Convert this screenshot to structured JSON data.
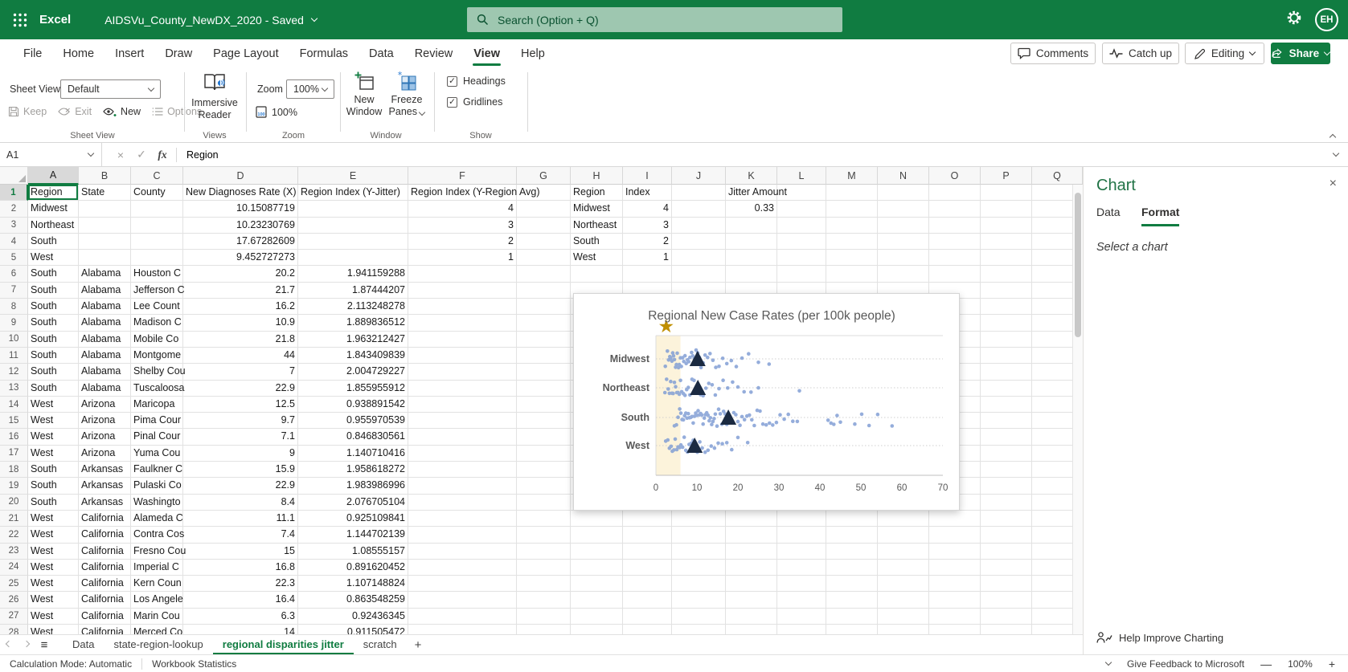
{
  "colors": {
    "brand_green": "#107C41",
    "panel_title_green": "#217346",
    "dot_blue": "#7E9CD4",
    "triangle_navy": "#1B2A41",
    "star_gold": "#C08F00",
    "band_cream": "#FCF3DB"
  },
  "titlebar": {
    "app_name": "Excel",
    "document_title": "AIDSVu_County_NewDX_2020  -  Saved",
    "search_placeholder": "Search (Option + Q)",
    "avatar_initials": "EH"
  },
  "ribbon_tabs": [
    "File",
    "Home",
    "Insert",
    "Draw",
    "Page Layout",
    "Formulas",
    "Data",
    "Review",
    "View",
    "Help"
  ],
  "active_ribbon_tab": "View",
  "header_actions": {
    "comments": "Comments",
    "catch_up": "Catch up",
    "editing": "Editing",
    "share": "Share"
  },
  "ribbon": {
    "sheet_view": {
      "label": "Sheet View",
      "value": "Default",
      "keep": "Keep",
      "exit": "Exit",
      "new": "New",
      "options": "Options",
      "group_label": "Sheet View"
    },
    "views": {
      "immersive_reader": "Immersive Reader",
      "group_label": "Views"
    },
    "zoom": {
      "label": "Zoom",
      "value": "100%",
      "zoom_to_100": "100%",
      "group_label": "Zoom"
    },
    "window": {
      "new_window": "New Window",
      "freeze_panes": "Freeze Panes",
      "group_label": "Window"
    },
    "show": {
      "headings": "Headings",
      "gridlines": "Gridlines",
      "group_label": "Show"
    }
  },
  "formula_bar": {
    "name_box": "A1",
    "content": "Region"
  },
  "grid": {
    "column_letters": [
      "A",
      "B",
      "C",
      "D",
      "E",
      "F",
      "G",
      "H",
      "I",
      "J",
      "K",
      "L",
      "M",
      "N",
      "O",
      "P",
      "Q"
    ],
    "selected_cell": "A1",
    "main_rows": [
      [
        "Region",
        "State",
        "County",
        "New Diagnoses Rate (X)",
        "Region Index (Y-Jitter)",
        "Region Index (Y-Region Avg)"
      ],
      [
        "Midwest",
        "",
        "",
        "10.15087719",
        "",
        "4"
      ],
      [
        "Northeast",
        "",
        "",
        "10.23230769",
        "",
        "3"
      ],
      [
        "South",
        "",
        "",
        "17.67282609",
        "",
        "2"
      ],
      [
        "West",
        "",
        "",
        "9.452727273",
        "",
        "1"
      ],
      [
        "South",
        "Alabama",
        "Houston C",
        "20.2",
        "1.941159288",
        ""
      ],
      [
        "South",
        "Alabama",
        "Jefferson C",
        "21.7",
        "1.87444207",
        ""
      ],
      [
        "South",
        "Alabama",
        "Lee Count",
        "16.2",
        "2.113248278",
        ""
      ],
      [
        "South",
        "Alabama",
        "Madison C",
        "10.9",
        "1.889836512",
        ""
      ],
      [
        "South",
        "Alabama",
        "Mobile Co",
        "21.8",
        "1.963212427",
        ""
      ],
      [
        "South",
        "Alabama",
        "Montgome",
        "44",
        "1.843409839",
        ""
      ],
      [
        "South",
        "Alabama",
        "Shelby Cou",
        "7",
        "2.004729227",
        ""
      ],
      [
        "South",
        "Alabama",
        "Tuscaloosa",
        "22.9",
        "1.855955912",
        ""
      ],
      [
        "West",
        "Arizona",
        "Maricopa",
        "12.5",
        "0.938891542",
        ""
      ],
      [
        "West",
        "Arizona",
        "Pima Cour",
        "9.7",
        "0.955970539",
        ""
      ],
      [
        "West",
        "Arizona",
        "Pinal Cour",
        "7.1",
        "0.846830561",
        ""
      ],
      [
        "West",
        "Arizona",
        "Yuma Cou",
        "9",
        "1.140710416",
        ""
      ],
      [
        "South",
        "Arkansas",
        "Faulkner C",
        "15.9",
        "1.958618272",
        ""
      ],
      [
        "South",
        "Arkansas",
        "Pulaski Co",
        "22.9",
        "1.983986996",
        ""
      ],
      [
        "South",
        "Arkansas",
        "Washingto",
        "8.4",
        "2.076705104",
        ""
      ],
      [
        "West",
        "California",
        "Alameda C",
        "11.1",
        "0.925109841",
        ""
      ],
      [
        "West",
        "California",
        "Contra Cos",
        "7.4",
        "1.144702139",
        ""
      ],
      [
        "West",
        "California",
        "Fresno Cou",
        "15",
        "1.08555157",
        ""
      ],
      [
        "West",
        "California",
        "Imperial C",
        "16.8",
        "0.891620452",
        ""
      ],
      [
        "West",
        "California",
        "Kern Coun",
        "22.3",
        "1.107148824",
        ""
      ],
      [
        "West",
        "California",
        "Los Angele",
        "16.4",
        "0.863548259",
        ""
      ],
      [
        "West",
        "California",
        "Marin Cou",
        "6.3",
        "0.92436345",
        ""
      ],
      [
        "West",
        "California",
        "Merced Co",
        "14",
        "0.911505472",
        ""
      ]
    ],
    "lookup_table": {
      "rows": [
        [
          "Region",
          "Index"
        ],
        [
          "Midwest",
          "4"
        ],
        [
          "Northeast",
          "3"
        ],
        [
          "South",
          "2"
        ],
        [
          "West",
          "1"
        ]
      ]
    },
    "jitter_table": {
      "header": "Jitter Amount",
      "value": "0.33"
    }
  },
  "chart_panel": {
    "title": "Chart",
    "tab_data": "Data",
    "tab_format": "Format",
    "active_tab": "Format",
    "empty_state": "Select a chart",
    "help_link": "Help Improve Charting"
  },
  "sheet_tabs": {
    "tabs": [
      "Data",
      "state-region-lookup",
      "regional disparities jitter",
      "scratch"
    ],
    "active": "regional disparities jitter"
  },
  "status_bar": {
    "calculation_mode": "Calculation Mode: Automatic",
    "workbook_statistics": "Workbook Statistics",
    "feedback": "Give Feedback to Microsoft",
    "zoom_level": "100%"
  },
  "icons": {
    "star": "★",
    "close": "×",
    "hamburger": "≡",
    "plus": "+",
    "minus": "—",
    "cancel": "×",
    "check": "✓",
    "fx": "fx"
  },
  "chart_data": {
    "type": "scatter",
    "title": "Regional New Case Rates (per 100k people)",
    "categories": [
      "Midwest",
      "Northeast",
      "South",
      "West"
    ],
    "xlabel": "",
    "ylabel": "",
    "xlim": [
      0,
      70
    ],
    "x_ticks": [
      0,
      10,
      20,
      30,
      40,
      50,
      60,
      70
    ],
    "grid": "horizontal-dotted",
    "legend": false,
    "jitter_amount": 0.33,
    "highlight_band_x": [
      0,
      6
    ],
    "star_marker": {
      "x": 2.5,
      "position": "above-plot"
    },
    "average_marker": "triangle",
    "region_averages": [
      10.15087719,
      10.23230769,
      17.67282609,
      9.452727273
    ],
    "series": [
      {
        "name": "Midwest",
        "points": [
          2.3,
          2.8,
          3.1,
          3.4,
          3.6,
          3.9,
          4.1,
          4.3,
          4.5,
          4.8,
          5,
          5.2,
          5.5,
          5.7,
          6,
          6.2,
          6.5,
          6.8,
          7.1,
          7.4,
          7.7,
          8,
          8.3,
          8.7,
          9,
          9.4,
          9.8,
          10.2,
          10.6,
          11,
          11.5,
          12,
          12.6,
          13.2,
          13.9,
          14.6,
          15.4,
          16.3,
          17.3,
          18.4,
          19.6,
          21,
          22.6,
          25,
          27.6
        ]
      },
      {
        "name": "Northeast",
        "points": [
          2.2,
          2.6,
          3,
          3.3,
          3.6,
          3.9,
          4.2,
          4.5,
          4.8,
          5.1,
          5.4,
          5.7,
          6,
          6.3,
          6.7,
          7.1,
          7.5,
          7.9,
          8.3,
          8.8,
          9.3,
          9.8,
          10.3,
          10.9,
          11.5,
          12.2,
          12.9,
          13.7,
          14.5,
          15.4,
          16.4,
          17.5,
          18.7,
          20,
          21.5,
          23.2,
          25,
          35
        ]
      },
      {
        "name": "South",
        "points": [
          4.5,
          5,
          5.4,
          5.8,
          6.1,
          6.4,
          6.7,
          7,
          7.3,
          7.6,
          7.9,
          8.2,
          8.5,
          8.8,
          9.1,
          9.4,
          9.7,
          10,
          10.3,
          10.6,
          10.9,
          11.2,
          11.5,
          11.8,
          12.1,
          12.4,
          12.7,
          13,
          13.3,
          13.6,
          13.9,
          14.2,
          14.5,
          14.9,
          15.3,
          15.7,
          16.1,
          16.5,
          16.9,
          17.3,
          17.7,
          18.1,
          18.5,
          19,
          19.5,
          20,
          20.5,
          21,
          21.6,
          22.2,
          22.8,
          23.4,
          24,
          24.7,
          25.4,
          26.1,
          26.9,
          27.7,
          28.5,
          29.4,
          30.3,
          31.3,
          32.3,
          33.4,
          34.5,
          42,
          42.7,
          43.4,
          44.2,
          45,
          48.5,
          50.2,
          52,
          54.1,
          57.6
        ]
      },
      {
        "name": "West",
        "points": [
          2.4,
          2.9,
          3.3,
          3.7,
          4,
          4.4,
          4.7,
          5.1,
          5.4,
          5.8,
          6.1,
          6.5,
          6.9,
          7.3,
          7.7,
          8.1,
          8.6,
          9.1,
          9.6,
          10.1,
          10.7,
          11.3,
          12,
          12.7,
          13.5,
          14.3,
          15.2,
          16.2,
          17.3,
          18.5,
          20,
          22.4
        ]
      }
    ]
  }
}
